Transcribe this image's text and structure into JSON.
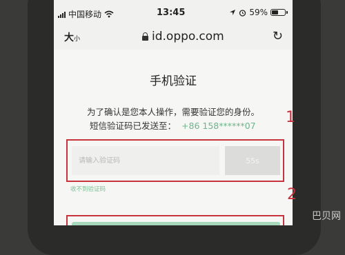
{
  "status_bar": {
    "carrier": "中国移动",
    "time": "13:45",
    "battery_percent": "59%",
    "battery_level": 0.59
  },
  "address_bar": {
    "text_size_label": "大",
    "text_size_small": "小",
    "url": "id.oppo.com"
  },
  "page": {
    "title": "手机验证",
    "description_line1": "为了确认是您本人操作，需要验证您的身份。",
    "description_line2": "短信验证码已发送至：",
    "phone_number": "+86 158******07",
    "code_input_placeholder": "请输入验证码",
    "timer_label": "55s",
    "no_code_link": "收不到验证码"
  },
  "annotations": {
    "step1": "1",
    "step2": "2"
  },
  "watermark": "巴贝网",
  "colors": {
    "annotation_red": "#c8323c",
    "accent_green": "#6db58a",
    "button_green": "#a6d8bb"
  }
}
